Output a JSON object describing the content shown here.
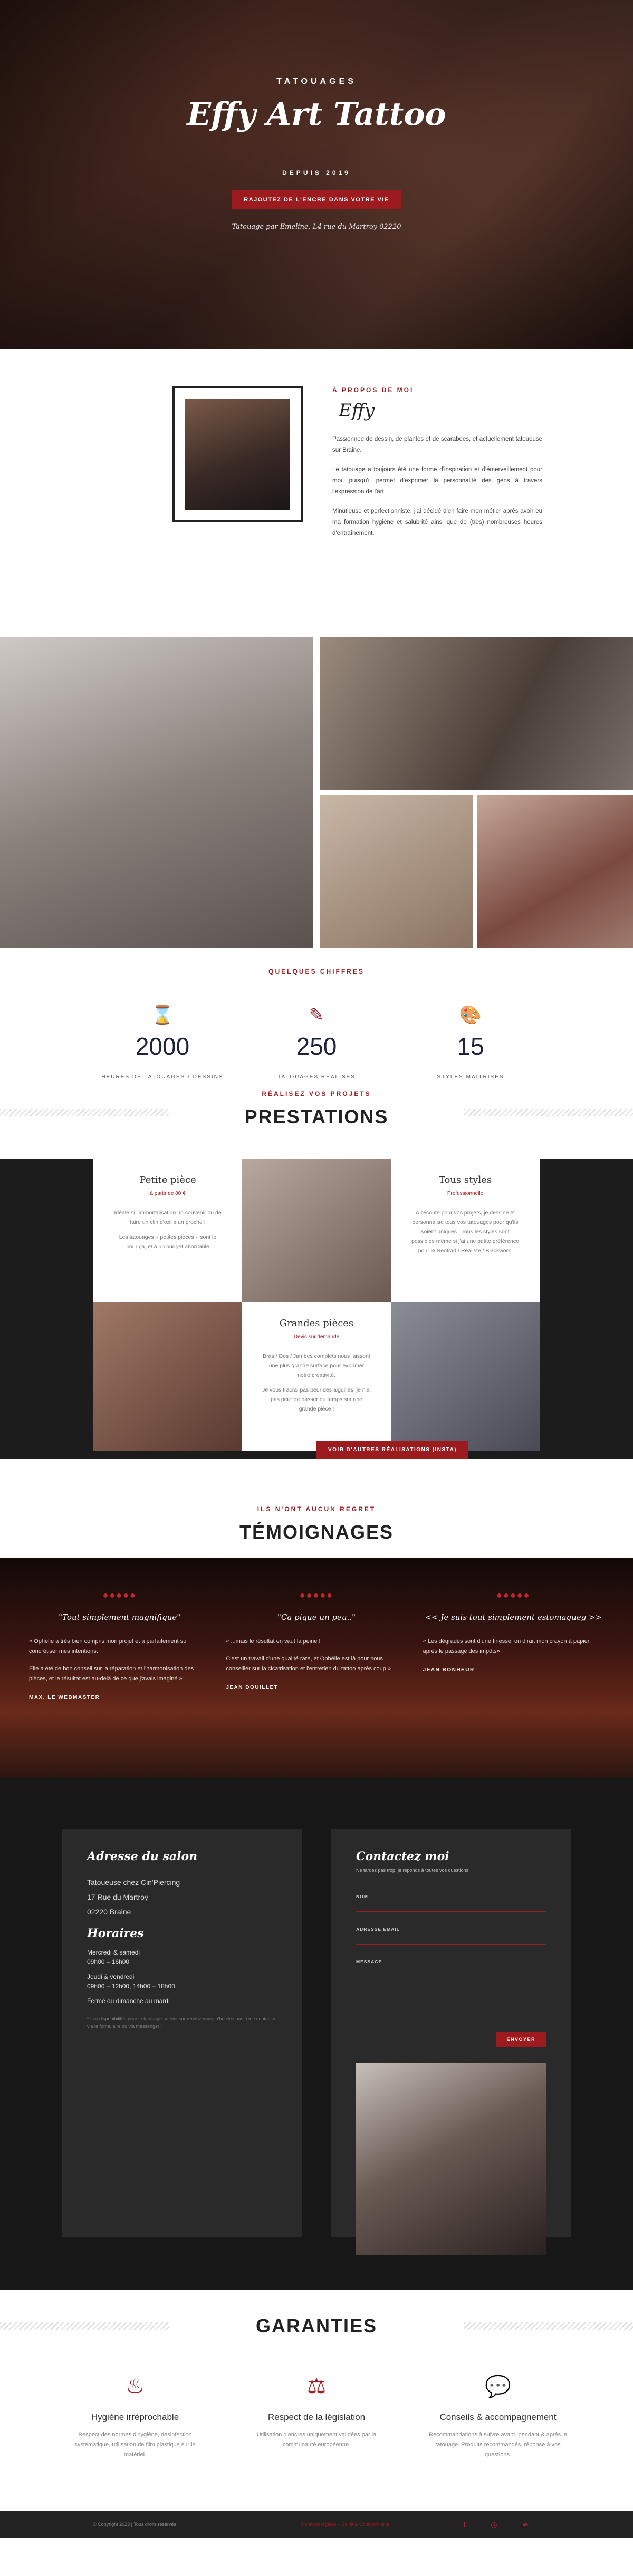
{
  "hero": {
    "kicker": "TATOUAGES",
    "title": "Effy Art Tattoo",
    "since": "DEPUIS 2019",
    "cta": "RAJOUTEZ DE L'ENCRE DANS VOTRE VIE",
    "caption": "Tatouage par Emeline, L4 rue du Martroy 02220"
  },
  "about": {
    "kicker": "À PROPOS DE MOI",
    "signature": "Effy",
    "paragraphs": [
      "Passionnée de dessin, de plantes et de scarabées, et actuellement tatoueuse sur Braine.",
      "Le tatouage a toujours été une forme d'inspiration et d'émerveillement pour moi, puisqu'il permet d'exprimer la personnalité des gens à travers l'expression de l'art.",
      "Minutieuse et perfectionniste, j'ai décidé d'en faire mon métier après avoir eu ma formation hygiène et salubrité ainsi que de (très) nombreuses heures d'entraînement."
    ]
  },
  "stats": {
    "title": "QUELQUES CHIFFRES",
    "items": [
      {
        "icon": "hourglass-icon",
        "glyph": "⌛",
        "value": "2000",
        "label": "HEURES DE TATOUAGES / DESSINS"
      },
      {
        "icon": "tattoo-machine-icon",
        "glyph": "✎",
        "value": "250",
        "label": "TATOUAGES RÉALISÉS"
      },
      {
        "icon": "palette-icon",
        "glyph": "🎨",
        "value": "15",
        "label": "STYLES MAÎTRISÉS"
      }
    ]
  },
  "prestations": {
    "kicker": "RÉALISEZ VOS PROJETS",
    "title": "PRESTATIONS",
    "cards": [
      {
        "title": "Petite pièce",
        "sub": "à partir de 80 €",
        "p1": "Idéale si l'immortalisation un souvenir ou de faire un clin d'œil à un proche !",
        "p2": "Les tatouages « petites pièces » sont le pour ça, et à un budget abordable"
      },
      {
        "title": "Tous styles",
        "sub": "Professionnelle",
        "p1": "À l'écoute pour vos projets, je dessine et personnalise tous vos tatouages pour qu'ils soient uniques ! Tous les styles sont possibles même si j'ai une petite préférence pour le Neotrad / Réaliste / Blackwork."
      },
      {
        "title": "Grandes pièces",
        "sub": "Devis sur demande",
        "p1": "Bras / Dos / Jambes complets nous laissent une plus grande surface pour exprimer notre créativité.",
        "p2": "Je vous tracrai pas peur des aiguilles, je n'ai pas peur de passer du temps sur une grande pièce !"
      }
    ],
    "cta": "VOIR D'AUTRES RÉALISATIONS (INSTA)"
  },
  "testimonials": {
    "kicker": "ILS N'ONT AUCUN REGRET",
    "title": "TÉMOIGNAGES",
    "stars": "●●●●●",
    "items": [
      {
        "quote": "\"Tout simplement magnifique\"",
        "p1": "« Ophélie a très bien compris mon projet et a parfaitement su concrétiser mes intentions.",
        "p2": "Elle a été de bon conseil sur la réparation et l'harmonisation des pièces, et le résultat est au-delà de ce que j'avais imaginé »",
        "author": "MAX, LE WEBMASTER"
      },
      {
        "quote": "\"Ca pique un peu..\"",
        "p1": "« ...mais le résultat en vaut la peine !",
        "p2": "C'est un travail d'une qualité rare, et Ophélie est là pour nous conseiller sur la cicatrisation et l'entretien du tattoo après coup »",
        "author": "JEAN DOUILLET"
      },
      {
        "quote": "<< Je suis tout simplement estomaqueg >>",
        "p1": "« Les dégradés sont d'une finesse, on dirait mon crayon à papier après le passage des impôts»",
        "author": "JEAN BONHEUR"
      }
    ]
  },
  "contact": {
    "address_title": "Adresse du salon",
    "address_lines": [
      "Tatoueuse chez Cin'Piercing",
      "17 Rue du Martroy",
      "02220 Braine"
    ],
    "hours_title": "Horaires",
    "hours_lines": [
      "Mercredi & samedi",
      "09h00 – 16h00",
      "Jeudi & vendredi",
      "09h00 – 12h00, 14h00 – 18h00",
      "Fermé du dimanche au mardi"
    ],
    "note": "* Les disponibilités pour le tatouage se font sur rendez-vous, n'hésitez pas à me contacter via le formulaire ou via messenger !",
    "form_title": "Contactez moi",
    "form_sub": "Ne tardez pas trop, je réponds à toutes vos questions",
    "fields": [
      "NOM",
      "ADRESSE EMAIL",
      "MESSAGE"
    ],
    "submit": "ENVOYER"
  },
  "guarantees": {
    "title": "GARANTIES",
    "items": [
      {
        "icon": "hygiene-icon",
        "glyph": "♨",
        "title": "Hygiène irréprochable",
        "text": "Respect des normes d'hygiène, désinfection systématique, utilisation de film plastique sur le matériel."
      },
      {
        "icon": "scales-icon",
        "glyph": "⚖",
        "title": "Respect de la législation",
        "text": "Utilisation d'encres uniquement validées par la communauté européenne."
      },
      {
        "icon": "chat-icon",
        "glyph": "💬",
        "title": "Conseils & accompagnement",
        "text": "Recommandations à suivre avant, pendant & après le tatouage. Produits recommandés, réponse à vos questions."
      }
    ]
  },
  "footer": {
    "copyright": "© Copyright 2023 | Tous droits réservés",
    "links": "Mentions légales – Sel fit & Confidentialité",
    "social": "f ◎ ≋"
  },
  "colors": {
    "accent": "#9b1b1f",
    "dark": "#1c1c1c",
    "navy": "#1c2340"
  }
}
